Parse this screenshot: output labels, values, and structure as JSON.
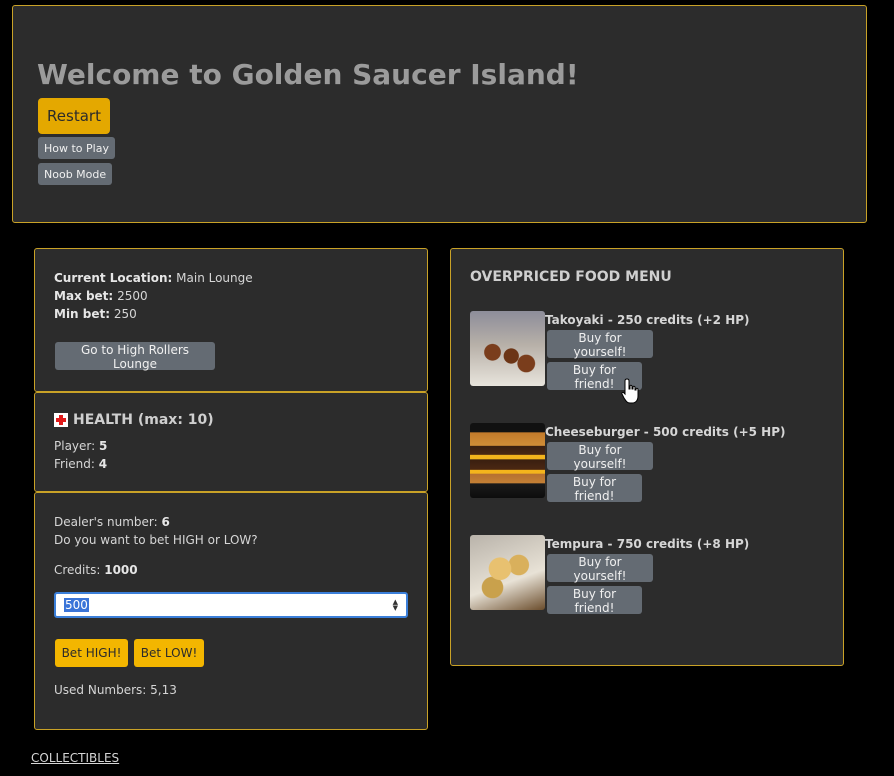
{
  "header": {
    "title": "Welcome to Golden Saucer Island!",
    "restart_label": "Restart",
    "how_to_play_label": "How to Play",
    "noob_mode_label": "Noob Mode"
  },
  "location": {
    "current_location_label": "Current Location:",
    "current_location_value": "Main Lounge",
    "max_bet_label": "Max bet:",
    "max_bet_value": "2500",
    "min_bet_label": "Min bet:",
    "min_bet_value": "250",
    "goto_button_label": "Go to High Rollers Lounge"
  },
  "health": {
    "title": "HEALTH (max: 10)",
    "player_label": "Player:",
    "player_value": "5",
    "friend_label": "Friend:",
    "friend_value": "4"
  },
  "betting": {
    "dealer_label": "Dealer's number:",
    "dealer_value": "6",
    "question": "Do you want to bet HIGH or LOW?",
    "credits_label": "Credits:",
    "credits_value": "1000",
    "bet_input_value": "500",
    "bet_high_label": "Bet HIGH!",
    "bet_low_label": "Bet LOW!",
    "used_numbers": "Used Numbers: 5,13"
  },
  "food_menu": {
    "title": "OVERPRICED FOOD MENU",
    "items": [
      {
        "name": "Takoyaki - 250 credits (+2 HP)",
        "image": "takoyaki-image"
      },
      {
        "name": "Cheeseburger - 500 credits (+5 HP)",
        "image": "cheeseburger-image"
      },
      {
        "name": "Tempura - 750 credits (+8 HP)",
        "image": "tempura-image"
      }
    ],
    "buy_self_label": "Buy for yourself!",
    "buy_friend_label": "Buy for friend!"
  },
  "footer": {
    "collectibles_label": "COLLECTIBLES"
  },
  "colors": {
    "border_gold": "#c9a227",
    "button_gold": "#f3b600",
    "button_gray": "#646b73",
    "panel_bg": "#2c2c2c"
  }
}
